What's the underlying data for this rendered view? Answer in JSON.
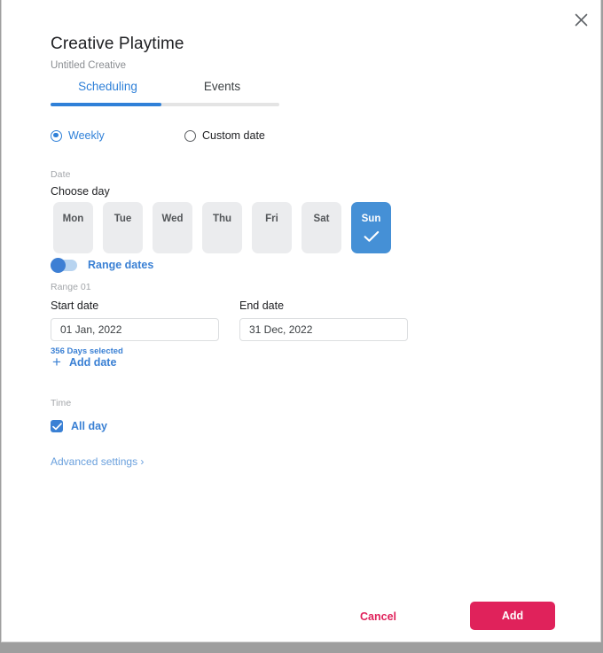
{
  "dialog": {
    "close_icon": "close-icon",
    "title": "Creative Playtime",
    "subtitle": "Untitled Creative"
  },
  "tabs": [
    {
      "label": "Scheduling",
      "active": true
    },
    {
      "label": "Events",
      "active": false
    }
  ],
  "mode_options": [
    {
      "label": "Weekly",
      "selected": true
    },
    {
      "label": "Custom date",
      "selected": false
    }
  ],
  "date_section": {
    "section_label": "Date",
    "title": "Choose day",
    "days": [
      {
        "label": "Mon",
        "selected": false
      },
      {
        "label": "Tue",
        "selected": false
      },
      {
        "label": "Wed",
        "selected": false
      },
      {
        "label": "Thu",
        "selected": false
      },
      {
        "label": "Fri",
        "selected": false
      },
      {
        "label": "Sat",
        "selected": false
      },
      {
        "label": "Sun",
        "selected": true
      }
    ],
    "range_toggle": {
      "label": "Range dates",
      "on": true
    },
    "range_number": "Range 01",
    "start": {
      "label": "Start date",
      "value": "01 Jan, 2022",
      "placeholder": "Start date"
    },
    "end": {
      "label": "End date",
      "value": "31 Dec, 2022",
      "placeholder": "End date"
    },
    "days_selected": "356 Days selected",
    "add_date_label": "Add date"
  },
  "time_section": {
    "section_label": "Time",
    "all_day": {
      "label": "All day",
      "checked": true
    }
  },
  "advanced_settings_label": "Advanced settings ›",
  "footer": {
    "cancel_label": "Cancel",
    "add_label": "Add"
  },
  "colors": {
    "accent_blue": "#3a80d4",
    "tab_blue": "#2f80d8",
    "chip_selected": "#4590d6",
    "chip_idle": "#ebecee",
    "primary_red": "#e0225b",
    "muted_gray": "#a3a6aa"
  }
}
